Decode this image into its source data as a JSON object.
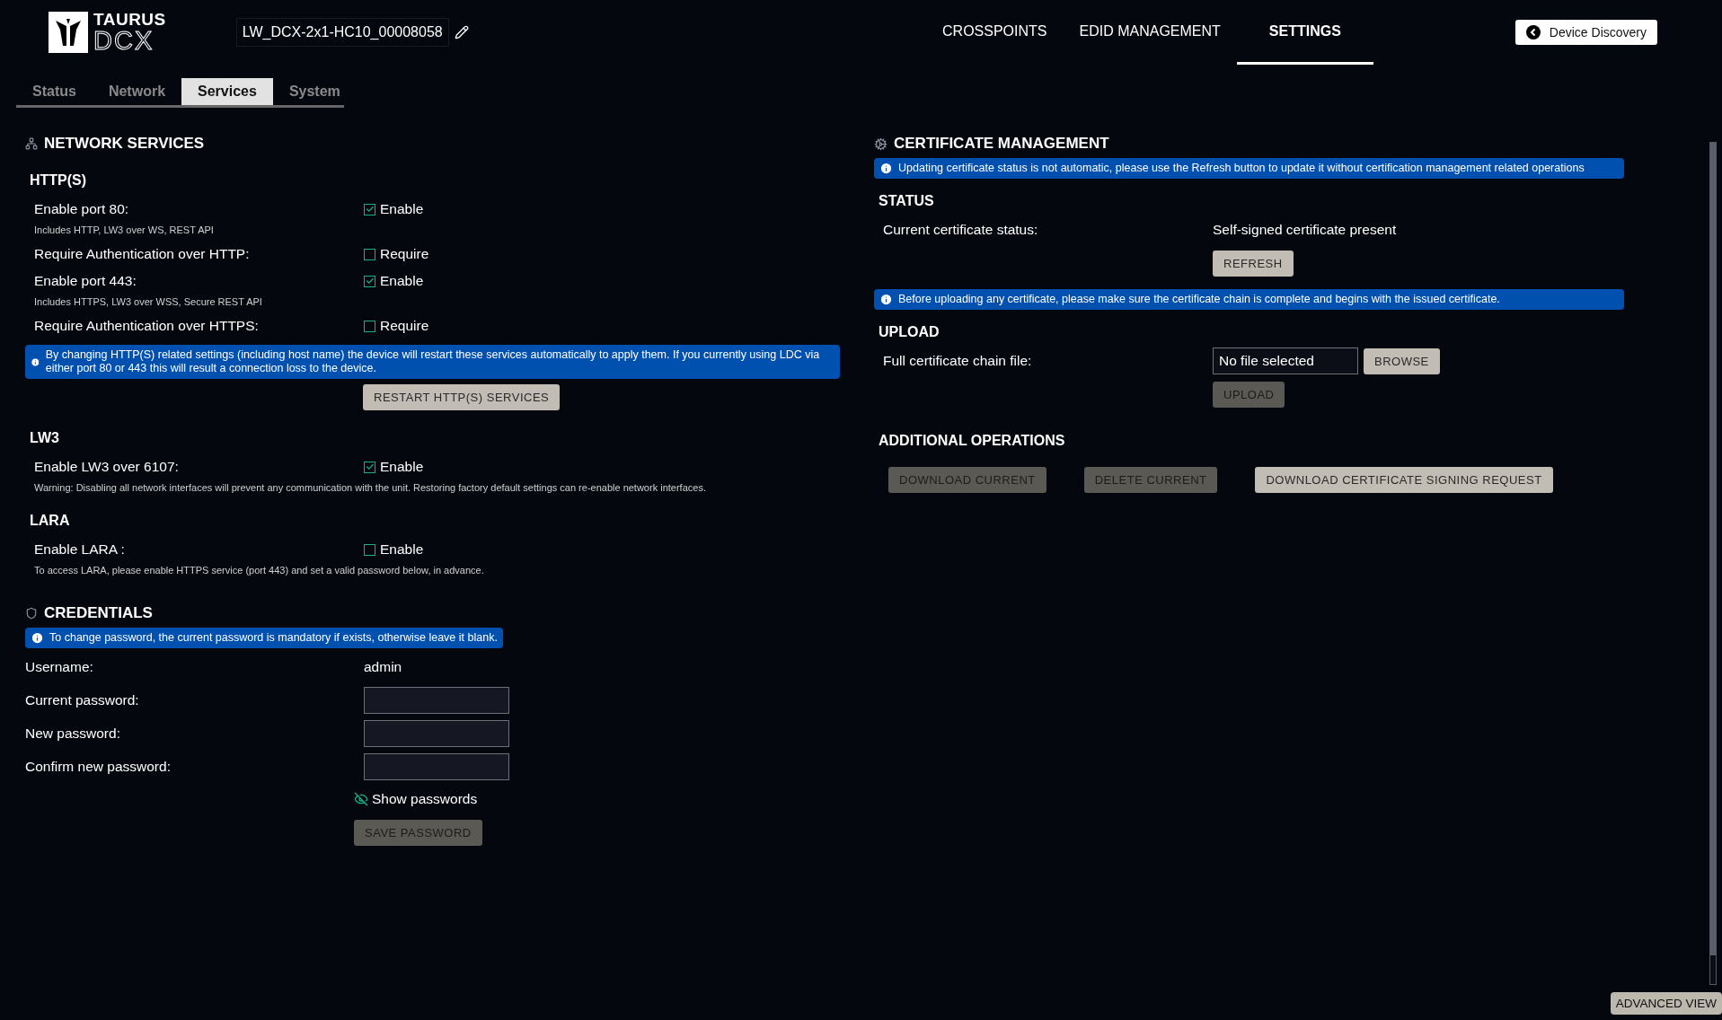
{
  "header": {
    "logo": {
      "brand": "TAURUS",
      "product": "DCX"
    },
    "device_name": "LW_DCX-2x1-HC10_00008058",
    "nav": [
      {
        "label": "CROSSPOINTS",
        "selected": false
      },
      {
        "label": "EDID MANAGEMENT",
        "selected": false
      },
      {
        "label": "SETTINGS",
        "selected": true
      }
    ],
    "back_button": "Device Discovery"
  },
  "tabs": [
    {
      "label": "Status",
      "selected": false
    },
    {
      "label": "Network",
      "selected": false
    },
    {
      "label": "Services",
      "selected": true
    },
    {
      "label": "System",
      "selected": false
    }
  ],
  "network_services": {
    "title": "NETWORK SERVICES",
    "groups": [
      {
        "title": "HTTP(S)",
        "rows": [
          {
            "label": "Enable port 80:",
            "option": "Enable",
            "checked": true,
            "note": "Includes HTTP, LW3 over WS, REST API"
          },
          {
            "label": "Require Authentication over HTTP:",
            "option": "Require",
            "checked": false
          },
          {
            "label": "Enable port 443:",
            "option": "Enable",
            "checked": true,
            "note": "Includes HTTPS, LW3 over WSS, Secure REST API"
          },
          {
            "label": "Require Authentication over HTTPS:",
            "option": "Require",
            "checked": false
          }
        ],
        "info": "By changing HTTP(S) related settings (including host name) the device will restart these services automatically to apply them. If you currently using LDC via either port 80 or 443 this will result a connection loss to the device.",
        "button": {
          "label": "RESTART HTTP(S) SERVICES",
          "disabled": false
        }
      },
      {
        "title": "LW3",
        "rows": [
          {
            "label": "Enable LW3 over 6107:",
            "option": "Enable",
            "checked": true,
            "note": "Warning: Disabling all network interfaces will prevent any communication with the unit. Restoring factory default settings can re-enable network interfaces."
          }
        ]
      },
      {
        "title": "LARA",
        "rows": [
          {
            "label": "Enable LARA :",
            "option": "Enable",
            "checked": false,
            "note": "To access LARA, please enable HTTPS service (port 443) and set a valid password below, in advance."
          }
        ]
      }
    ]
  },
  "credentials": {
    "title": "CREDENTIALS",
    "info": "To change password, the current password is mandatory if exists, otherwise leave it blank.",
    "username_label": "Username:",
    "username": "admin",
    "fields": [
      {
        "label": "Current password:"
      },
      {
        "label": "New password:"
      },
      {
        "label": "Confirm new password:"
      }
    ],
    "show_passwords": "Show passwords",
    "save_button": {
      "label": "SAVE PASSWORD",
      "disabled": true
    }
  },
  "certificate": {
    "title": "CERTIFICATE MANAGEMENT",
    "info": "Updating certificate status is not automatic, please use the Refresh button to update it without certification management related operations",
    "status": {
      "title": "STATUS",
      "label": "Current certificate status:",
      "value": "Self-signed certificate present",
      "button": {
        "label": "REFRESH",
        "disabled": false
      }
    },
    "info2": "Before uploading any certificate, please make sure the certificate chain is complete and begins with the issued certificate.",
    "upload": {
      "title": "UPLOAD",
      "label": "Full certificate chain file:",
      "file": "No file selected",
      "browse": {
        "label": "BROWSE",
        "disabled": false
      },
      "button": {
        "label": "UPLOAD",
        "disabled": true
      }
    },
    "additional": {
      "title": "ADDITIONAL OPERATIONS",
      "buttons": [
        {
          "label": "DOWNLOAD CURRENT",
          "disabled": true
        },
        {
          "label": "DELETE CURRENT",
          "disabled": true
        },
        {
          "label": "DOWNLOAD CERTIFICATE SIGNING REQUEST",
          "disabled": false
        }
      ]
    }
  },
  "advanced_button": "ADVANCED VIEW"
}
